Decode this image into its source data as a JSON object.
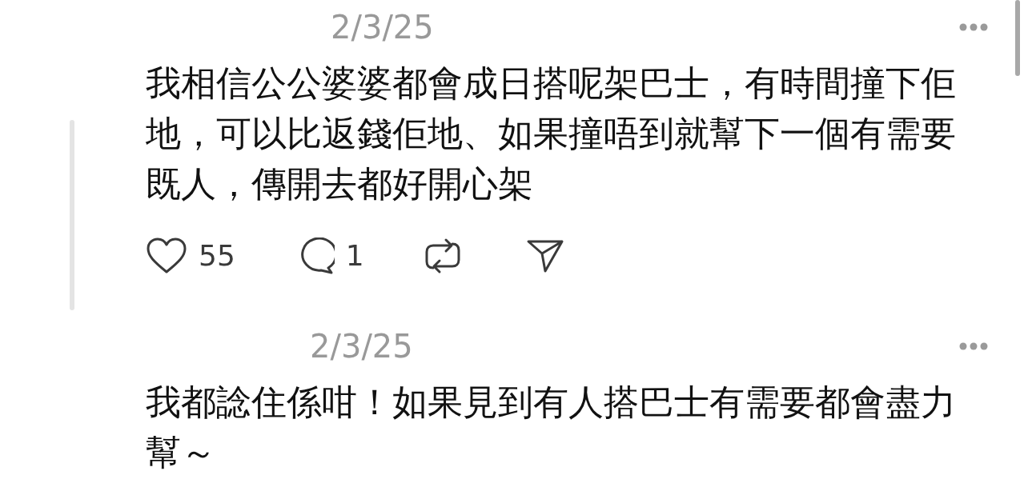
{
  "comments": [
    {
      "date": "2/3/25",
      "thread_line": true,
      "text": "我相信公公婆婆都會成日搭呢架巴士，有時間撞下佢地，可以比返錢佢地、如果撞唔到就幫下一個有需要既人，傳開去都好開心架",
      "actions": [
        {
          "kind": "like",
          "count": "55"
        },
        {
          "kind": "reply",
          "count": "1"
        },
        {
          "kind": "repost"
        },
        {
          "kind": "share"
        }
      ]
    },
    {
      "date": "2/3/25",
      "thread_line": false,
      "text": "我都諗住係咁！如果見到有人搭巴士有需要都會盡力幫～"
    }
  ]
}
